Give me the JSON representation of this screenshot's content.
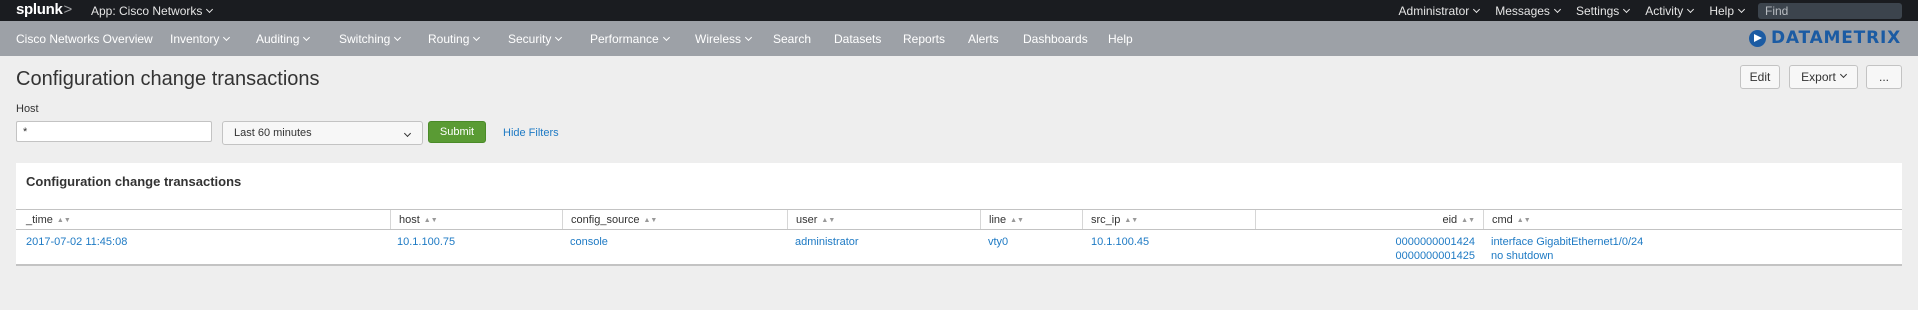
{
  "topbar": {
    "logo": "splunk",
    "logo_suffix": ">",
    "app": "App: Cisco Networks",
    "menus": [
      "Administrator",
      "Messages",
      "Settings",
      "Activity",
      "Help"
    ],
    "find_placeholder": "Find"
  },
  "nav": {
    "items": [
      "Cisco Networks Overview",
      "Inventory",
      "Auditing",
      "Switching",
      "Routing",
      "Security",
      "Performance",
      "Wireless",
      "Search",
      "Datasets",
      "Reports",
      "Alerts",
      "Dashboards",
      "Help"
    ],
    "brand": "DATAMETRIX",
    "brand_color": "#1b5ba3"
  },
  "page": {
    "title": "Configuration change transactions",
    "buttons": {
      "edit": "Edit",
      "export": "Export",
      "more": "..."
    }
  },
  "filters": {
    "host_label": "Host",
    "host_value": "*",
    "time_value": "Last 60 minutes",
    "submit": "Submit",
    "hide_filters": "Hide Filters",
    "submit_color": "#5a9b34"
  },
  "panel": {
    "title": "Configuration change transactions",
    "columns": [
      "_time",
      "host",
      "config_source",
      "user",
      "line",
      "src_ip",
      "eid",
      "cmd"
    ],
    "rows": [
      {
        "_time": "2017-07-02 11:45:08",
        "host": "10.1.100.75",
        "config_source": "console",
        "user": "administrator",
        "line": "vty0",
        "src_ip": "10.1.100.45",
        "eid": [
          "0000000001424",
          "0000000001425"
        ],
        "cmd": [
          "interface GigabitEthernet1/0/24",
          "no shutdown"
        ]
      }
    ],
    "link_color": "#1e7ac4"
  }
}
